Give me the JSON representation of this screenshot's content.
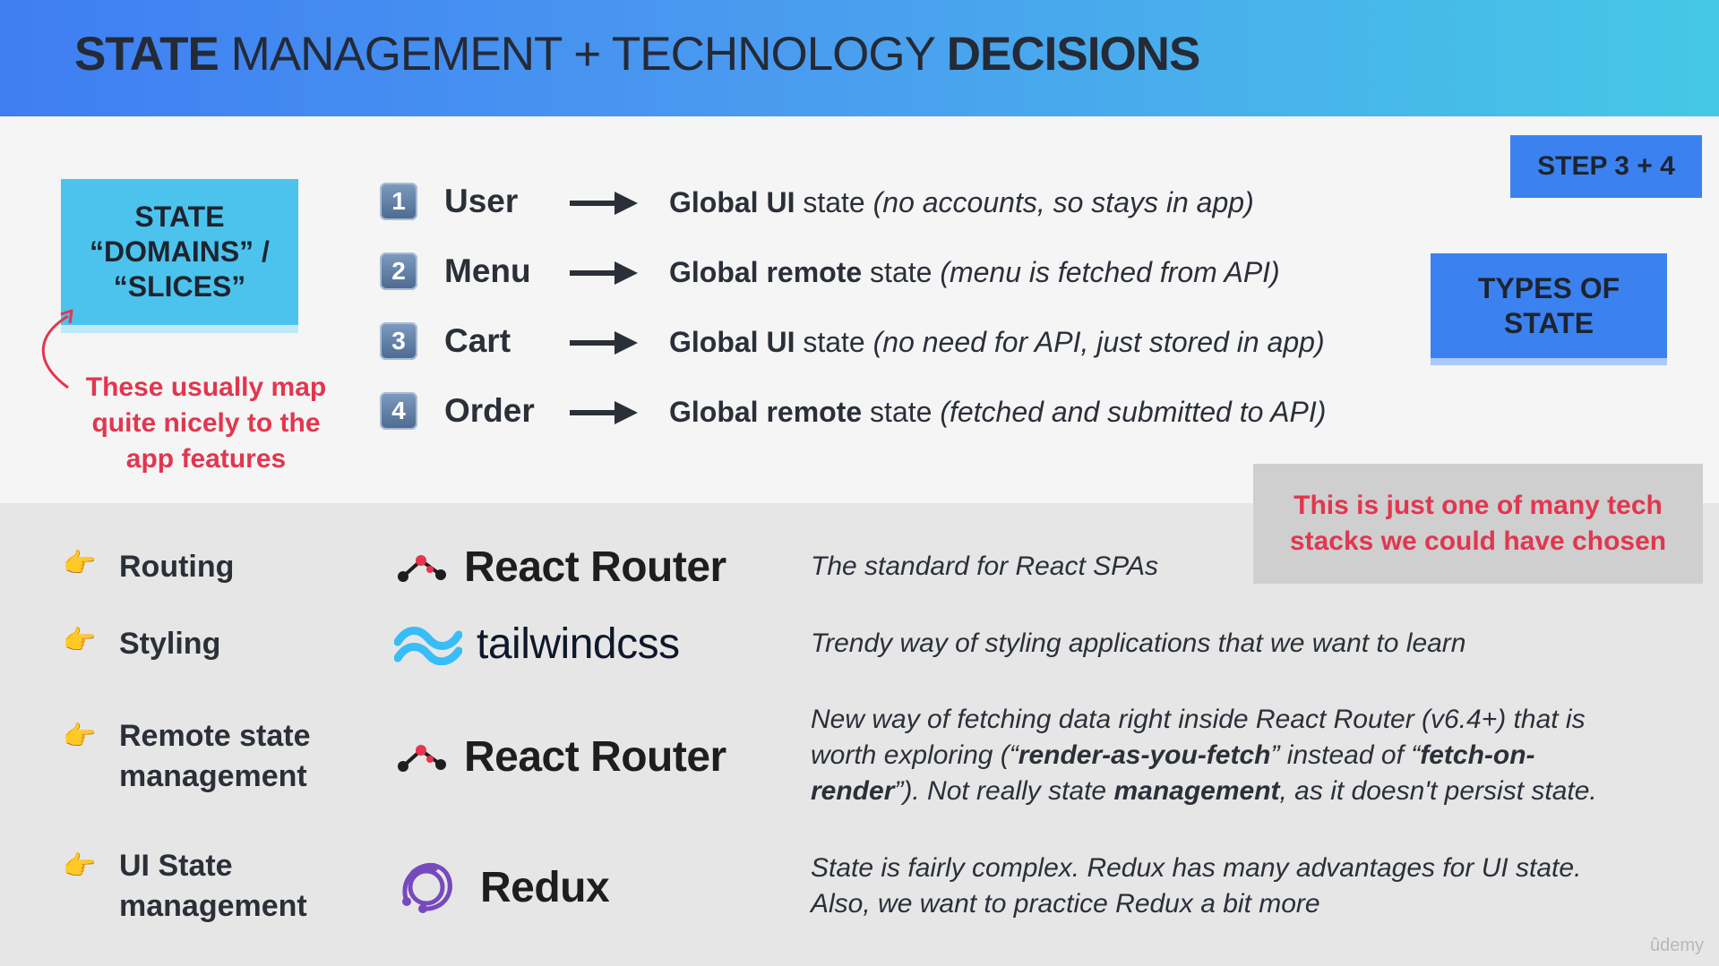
{
  "header": {
    "title_part1": "STATE",
    "title_part2": " MANAGEMENT + TECHNOLOGY ",
    "title_part3": "DECISIONS"
  },
  "domains_box": {
    "line1": "STATE",
    "line2": "“DOMAINS” /",
    "line3": "“SLICES”"
  },
  "domains_note": {
    "line1": "These usually map",
    "line2": "quite nicely to the",
    "line3": "app features"
  },
  "state_rows": [
    {
      "num": "1",
      "label": "User",
      "bold": "Global UI",
      "plain": " state ",
      "italic": "(no accounts, so stays in app)"
    },
    {
      "num": "2",
      "label": "Menu",
      "bold": "Global remote",
      "plain": " state ",
      "italic": "(menu is fetched from API)"
    },
    {
      "num": "3",
      "label": "Cart",
      "bold": "Global UI",
      "plain": " state ",
      "italic": "(no need for API, just stored in app)"
    },
    {
      "num": "4",
      "label": "Order",
      "bold": "Global remote",
      "plain": " state ",
      "italic": "(fetched and submitted to API)"
    }
  ],
  "step_box": "STEP 3 + 4",
  "types_box": {
    "line1": "TYPES OF",
    "line2": "STATE"
  },
  "gray_note": {
    "line1": "This is just one of many tech",
    "line2": "stacks we could have chosen"
  },
  "tech_rows": [
    {
      "label": "Routing",
      "logo": "React Router",
      "desc": "The standard for React SPAs"
    },
    {
      "label": "Styling",
      "logo": "tailwindcss",
      "desc": "Trendy way of styling applications that we want to learn"
    },
    {
      "label_line1": "Remote state",
      "label_line2": "management",
      "logo": "React Router",
      "desc_1": "New way of fetching data right inside React Router (v6.4+) that is",
      "desc_2a": "worth exploring (“",
      "desc_2b": "render-as-you-fetch",
      "desc_2c": "” instead of “",
      "desc_2d": "fetch-on-",
      "desc_3a": "render",
      "desc_3b": "”). Not really state ",
      "desc_3c": "management",
      "desc_3d": ", as it doesn't persist state."
    },
    {
      "label_line1": "UI State",
      "label_line2": "management",
      "logo": "Redux",
      "desc_1": "State is fairly complex. Redux has many advantages for UI state.",
      "desc_2": "Also, we want to practice Redux a bit more"
    }
  ],
  "icons": {
    "hand": "pointing-hand-icon",
    "arrow": "right-arrow-icon",
    "curve": "curved-arrow-icon"
  },
  "colors": {
    "accent_blue": "#3b82f0",
    "cyan": "#4cc3ec",
    "red": "#e2364f",
    "react_router_red": "#e8344e",
    "tailwind": "#38bdf8",
    "redux": "#764abc"
  },
  "watermark": "ûdemy"
}
